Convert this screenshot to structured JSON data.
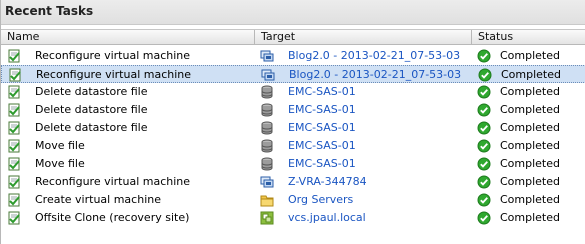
{
  "panel": {
    "title": "Recent Tasks"
  },
  "columns": {
    "name": "Name",
    "target": "Target",
    "status": "Status"
  },
  "tasks": [
    {
      "name": "Reconfigure virtual machine",
      "target": "Blog2.0 - 2013-02-21_07-53-03",
      "target_icon": "vm-icon",
      "status": "Completed",
      "selected": false
    },
    {
      "name": "Reconfigure virtual machine",
      "target": "Blog2.0 - 2013-02-21_07-53-03",
      "target_icon": "vm-icon",
      "status": "Completed",
      "selected": true
    },
    {
      "name": "Delete datastore file",
      "target": "EMC-SAS-01",
      "target_icon": "datastore-icon",
      "status": "Completed",
      "selected": false
    },
    {
      "name": "Delete datastore file",
      "target": "EMC-SAS-01",
      "target_icon": "datastore-icon",
      "status": "Completed",
      "selected": false
    },
    {
      "name": "Delete datastore file",
      "target": "EMC-SAS-01",
      "target_icon": "datastore-icon",
      "status": "Completed",
      "selected": false
    },
    {
      "name": "Move file",
      "target": "EMC-SAS-01",
      "target_icon": "datastore-icon",
      "status": "Completed",
      "selected": false
    },
    {
      "name": "Move file",
      "target": "EMC-SAS-01",
      "target_icon": "datastore-icon",
      "status": "Completed",
      "selected": false
    },
    {
      "name": "Reconfigure virtual machine",
      "target": "Z-VRA-344784",
      "target_icon": "vm-icon",
      "status": "Completed",
      "selected": false
    },
    {
      "name": "Create virtual machine",
      "target": "Org Servers",
      "target_icon": "folder-icon",
      "status": "Completed",
      "selected": false
    },
    {
      "name": "Offsite Clone (recovery site)",
      "target": "vcs.jpaul.local",
      "target_icon": "vcenter-icon",
      "status": "Completed",
      "selected": false
    }
  ],
  "colors": {
    "link": "#1a55c2",
    "selection": "#cfe0f4",
    "success": "#2fa82f"
  }
}
